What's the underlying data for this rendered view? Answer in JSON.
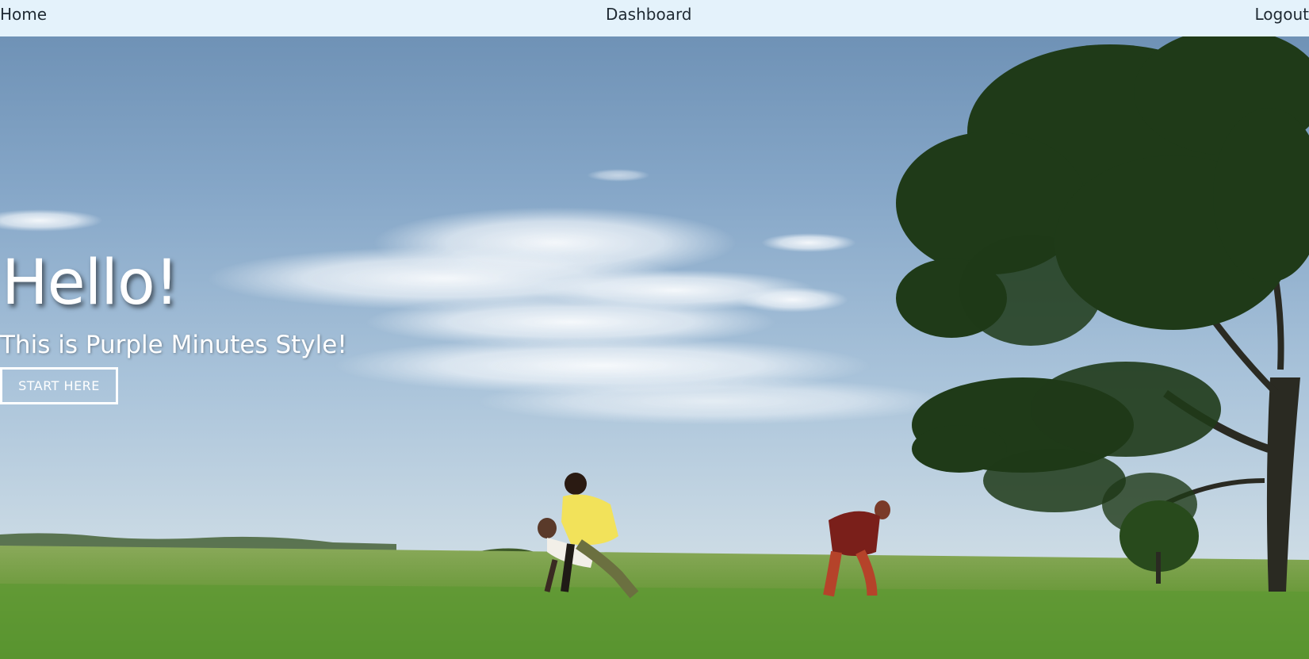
{
  "nav": {
    "home_label": "Home",
    "dashboard_label": "Dashboard",
    "logout_label": "Logout",
    "background": "#e4f2fb"
  },
  "hero": {
    "title": "Hello!",
    "subtitle": "This is Purple Minutes Style!",
    "cta_label": "START HERE",
    "background_image": "video-still-sky-field-tree-dancers"
  }
}
